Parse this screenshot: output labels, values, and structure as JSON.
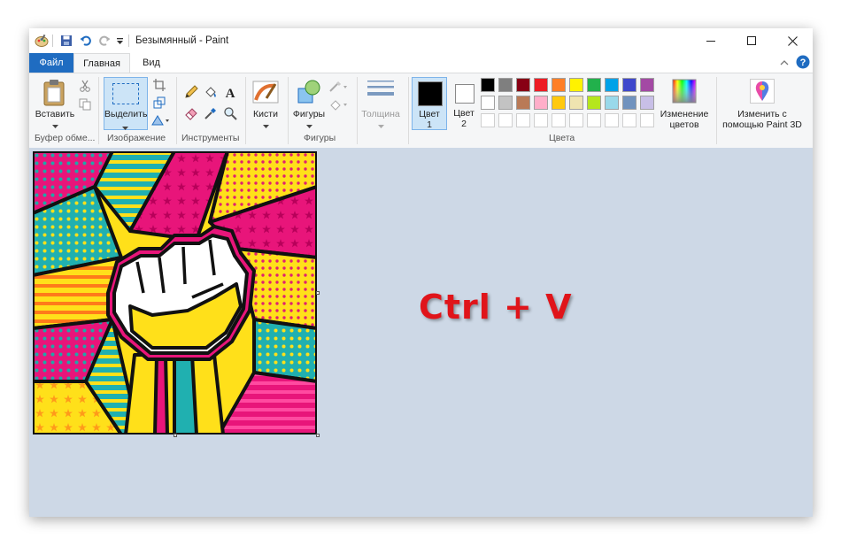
{
  "window": {
    "title": "Безымянный - Paint"
  },
  "tabs": {
    "file": "Файл",
    "home": "Главная",
    "view": "Вид"
  },
  "clipboard": {
    "paste_label": "Вставить",
    "group_label": "Буфер обме..."
  },
  "image": {
    "select_label": "Выделить",
    "group_label": "Изображение"
  },
  "tools": {
    "group_label": "Инструменты"
  },
  "brushes": {
    "label": "Кисти"
  },
  "shapes": {
    "label": "Фигуры",
    "group_label": "Фигуры"
  },
  "size": {
    "label": "Толщина"
  },
  "colors": {
    "color1_label": "Цвет",
    "color1_num": "1",
    "color2_label": "Цвет",
    "color2_num": "2",
    "group_label": "Цвета",
    "edit_label_1": "Изменение",
    "edit_label_2": "цветов",
    "color1_value": "#000000",
    "color2_value": "#ffffff",
    "palette_row1": [
      "#000000",
      "#7f7f7f",
      "#880015",
      "#ed1c24",
      "#ff7f27",
      "#fff200",
      "#22b14c",
      "#00a2e8",
      "#3f48cc",
      "#a349a4"
    ],
    "palette_row2": [
      "#ffffff",
      "#c3c3c3",
      "#b97a57",
      "#ffaec9",
      "#ffc90e",
      "#efe4b0",
      "#b5e61d",
      "#99d9ea",
      "#7092be",
      "#c8bfe7"
    ],
    "palette_row3": [
      "#ffffff",
      "#ffffff",
      "#ffffff",
      "#ffffff",
      "#ffffff",
      "#ffffff",
      "#ffffff",
      "#ffffff",
      "#ffffff",
      "#ffffff"
    ]
  },
  "paint3d": {
    "label_1": "Изменить с",
    "label_2": "помощью Paint 3D"
  },
  "overlay": {
    "text": "Ctrl + V"
  }
}
